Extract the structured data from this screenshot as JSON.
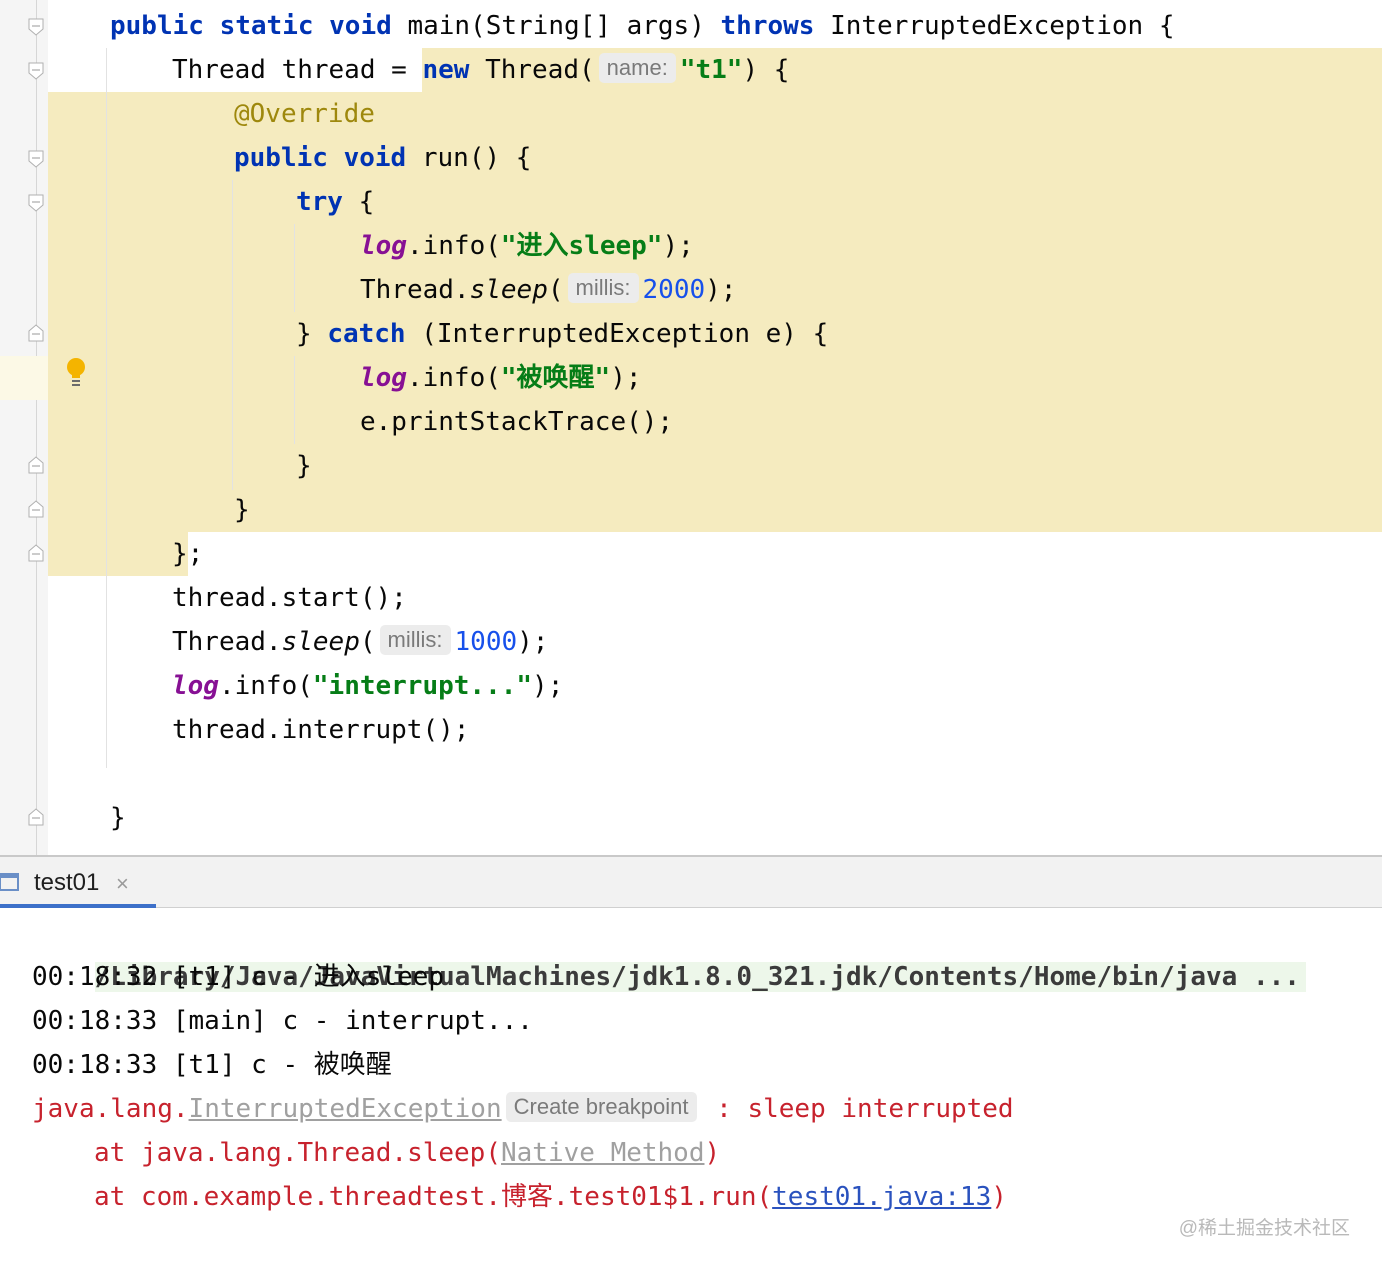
{
  "editor": {
    "lines": {
      "l1": {
        "kw1": "public",
        "kw2": "static",
        "kw3": "void",
        "t1": "main(String[] args)",
        "kw4": "throws",
        "t2": "InterruptedException {"
      },
      "l2": {
        "t1": "Thread thread = ",
        "kw": "new",
        "t2": "Thread(",
        "hint": "name:",
        "str": "\"t1\"",
        "t3": ") {"
      },
      "l3": {
        "ann": "@Override"
      },
      "l4": {
        "kw1": "public",
        "kw2": "void",
        "t1": "run() {"
      },
      "l5": {
        "kw": "try",
        "t1": "{"
      },
      "l6": {
        "field": "log",
        "t1": ".info(",
        "str": "\"进入sleep\"",
        "t2": ");"
      },
      "l7": {
        "t1": "Thread.",
        "method": "sleep",
        "t2": "(",
        "hint": "millis:",
        "num": "2000",
        "t3": ");"
      },
      "l8": {
        "t1": "}",
        "kw": "catch",
        "t2": "(InterruptedException e) {"
      },
      "l9": {
        "field": "log",
        "t1": ".info(",
        "str": "\"被唤醒\"",
        "t2": ");"
      },
      "l10": {
        "t1": "e.printStackTrace();"
      },
      "l11": {
        "t1": "}"
      },
      "l12": {
        "t1": "}"
      },
      "l13": {
        "t1": "};"
      },
      "l14": {
        "t1": "thread.start();"
      },
      "l15": {
        "t1": "Thread.",
        "method": "sleep",
        "t2": "(",
        "hint": "millis:",
        "num": "1000",
        "t3": ");"
      },
      "l16": {
        "field": "log",
        "t1": ".info(",
        "str": "\"interrupt...\"",
        "t2": ");"
      },
      "l17": {
        "t1": "thread.interrupt();"
      },
      "l18": {
        "t1": "}"
      }
    },
    "colors": {
      "keyword": "#0033b3",
      "string": "#067d17",
      "number": "#1750eb",
      "annotation": "#9e880d",
      "field": "#871094",
      "highlight": "#f5ebbf"
    }
  },
  "run_panel": {
    "tab_label": "test01",
    "tab_close": "×",
    "command": "/Library/Java/JavaVirtualMachines/jdk1.8.0_321.jdk/Contents/Home/bin/java ...",
    "log1": "00:18:32 [t1] c - 进入sleep",
    "log2": "00:18:33 [main] c - interrupt...",
    "log3": "00:18:33 [t1] c - 被唤醒",
    "exc_prefix": "java.lang.",
    "exc_link": "InterruptedException",
    "exc_hint": "Create breakpoint",
    "exc_msg": " : sleep interrupted",
    "st1_prefix": "at java.lang.Thread.sleep(",
    "st1_link": "Native Method",
    "st1_suffix": ")",
    "st2_prefix": "at com.example.threadtest.博客.test01$1.run(",
    "st2_link": "test01.java:13",
    "st2_suffix": ")",
    "colors": {
      "error": "#c7222d",
      "link": "#2a52be",
      "tab_underline": "#3d70c9"
    }
  },
  "watermark": "@稀土掘金技术社区"
}
